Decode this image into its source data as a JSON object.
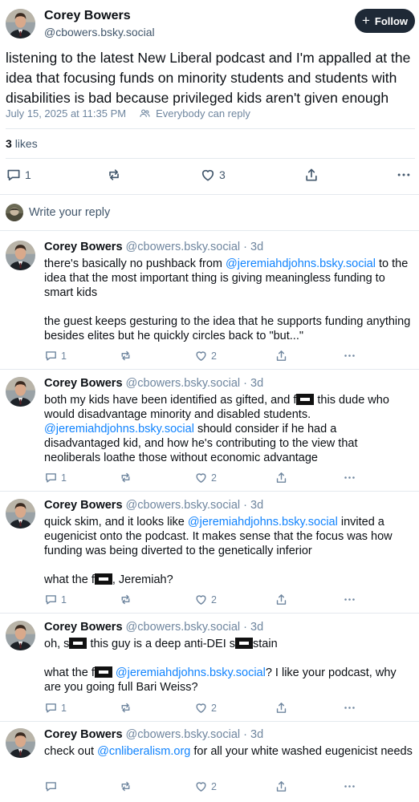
{
  "post": {
    "author_name": "Corey Bowers",
    "author_handle": "@cbowers.bsky.social",
    "follow_label": "Follow",
    "text": "listening to the latest New Liberal podcast and I'm appalled at the idea that focusing funds on minority students and students with disabilities is bad because privileged kids aren't given enough",
    "timestamp": "July 15, 2025 at 11:35 PM",
    "audience": "Everybody can reply",
    "likes_count": "3",
    "likes_label": "likes",
    "reply_count": "1",
    "like_count": "3"
  },
  "composer": {
    "placeholder": "Write your reply"
  },
  "replies": [
    {
      "name": "Corey Bowers",
      "handle": "@cbowers.bsky.social",
      "age": "· 3d",
      "p1_a": "there's basically no pushback from ",
      "p1_link": "@jeremiahdjohns.bsky.social",
      "p1_b": " to the idea that the most important thing is giving meaningless funding to smart kids",
      "p2": "the guest keeps gesturing to the idea that he supports funding anything besides elites but he quickly circles back to \"but...\"",
      "replies": "1",
      "likes": "2"
    },
    {
      "name": "Corey Bowers",
      "handle": "@cbowers.bsky.social",
      "age": "· 3d",
      "p1_a": "both my kids have been identified as gifted, and f",
      "p1_b": " this dude who would disadvantage minority and disabled students. ",
      "p1_link": "@jeremiahdjohns.bsky.social",
      "p1_c": " should consider if he had a disadvantaged kid, and how he's contributing to the view that neoliberals loathe those without economic advantage",
      "replies": "1",
      "likes": "2"
    },
    {
      "name": "Corey Bowers",
      "handle": "@cbowers.bsky.social",
      "age": "· 3d",
      "p1_a": "quick skim, and it looks like ",
      "p1_link": "@jeremiahdjohns.bsky.social",
      "p1_b": " invited a eugenicist onto the podcast. It makes sense that the focus was how funding was being diverted to the genetically inferior",
      "p2_a": "what the f",
      "p2_b": ", Jeremiah?",
      "replies": "1",
      "likes": "2"
    },
    {
      "name": "Corey Bowers",
      "handle": "@cbowers.bsky.social",
      "age": "· 3d",
      "p1_a": "oh, s",
      "p1_b": " this guy is a deep anti-DEI s",
      "p1_c": "stain",
      "p2_a": "what the f",
      "p2_link": "@jeremiahdjohns.bsky.social",
      "p2_b": "? I like your podcast, why are you going full Bari Weiss?",
      "replies": "1",
      "likes": "2"
    },
    {
      "name": "Corey Bowers",
      "handle": "@cbowers.bsky.social",
      "age": "· 3d",
      "p1_a": "check out ",
      "p1_link": "@cnliberalism.org",
      "p1_b": " for all your white washed eugenicist needs",
      "likes": "2"
    }
  ],
  "icons": {
    "reply": "speech-bubble-icon",
    "repost": "repost-arrows-icon",
    "like": "heart-icon",
    "share": "share-upload-icon",
    "more": "ellipsis-icon",
    "audience": "people-icon",
    "redaction": "redaction-block"
  },
  "colors": {
    "link": "#1083fe",
    "follow_bg": "#1e2936",
    "muted": "#6f869f"
  }
}
